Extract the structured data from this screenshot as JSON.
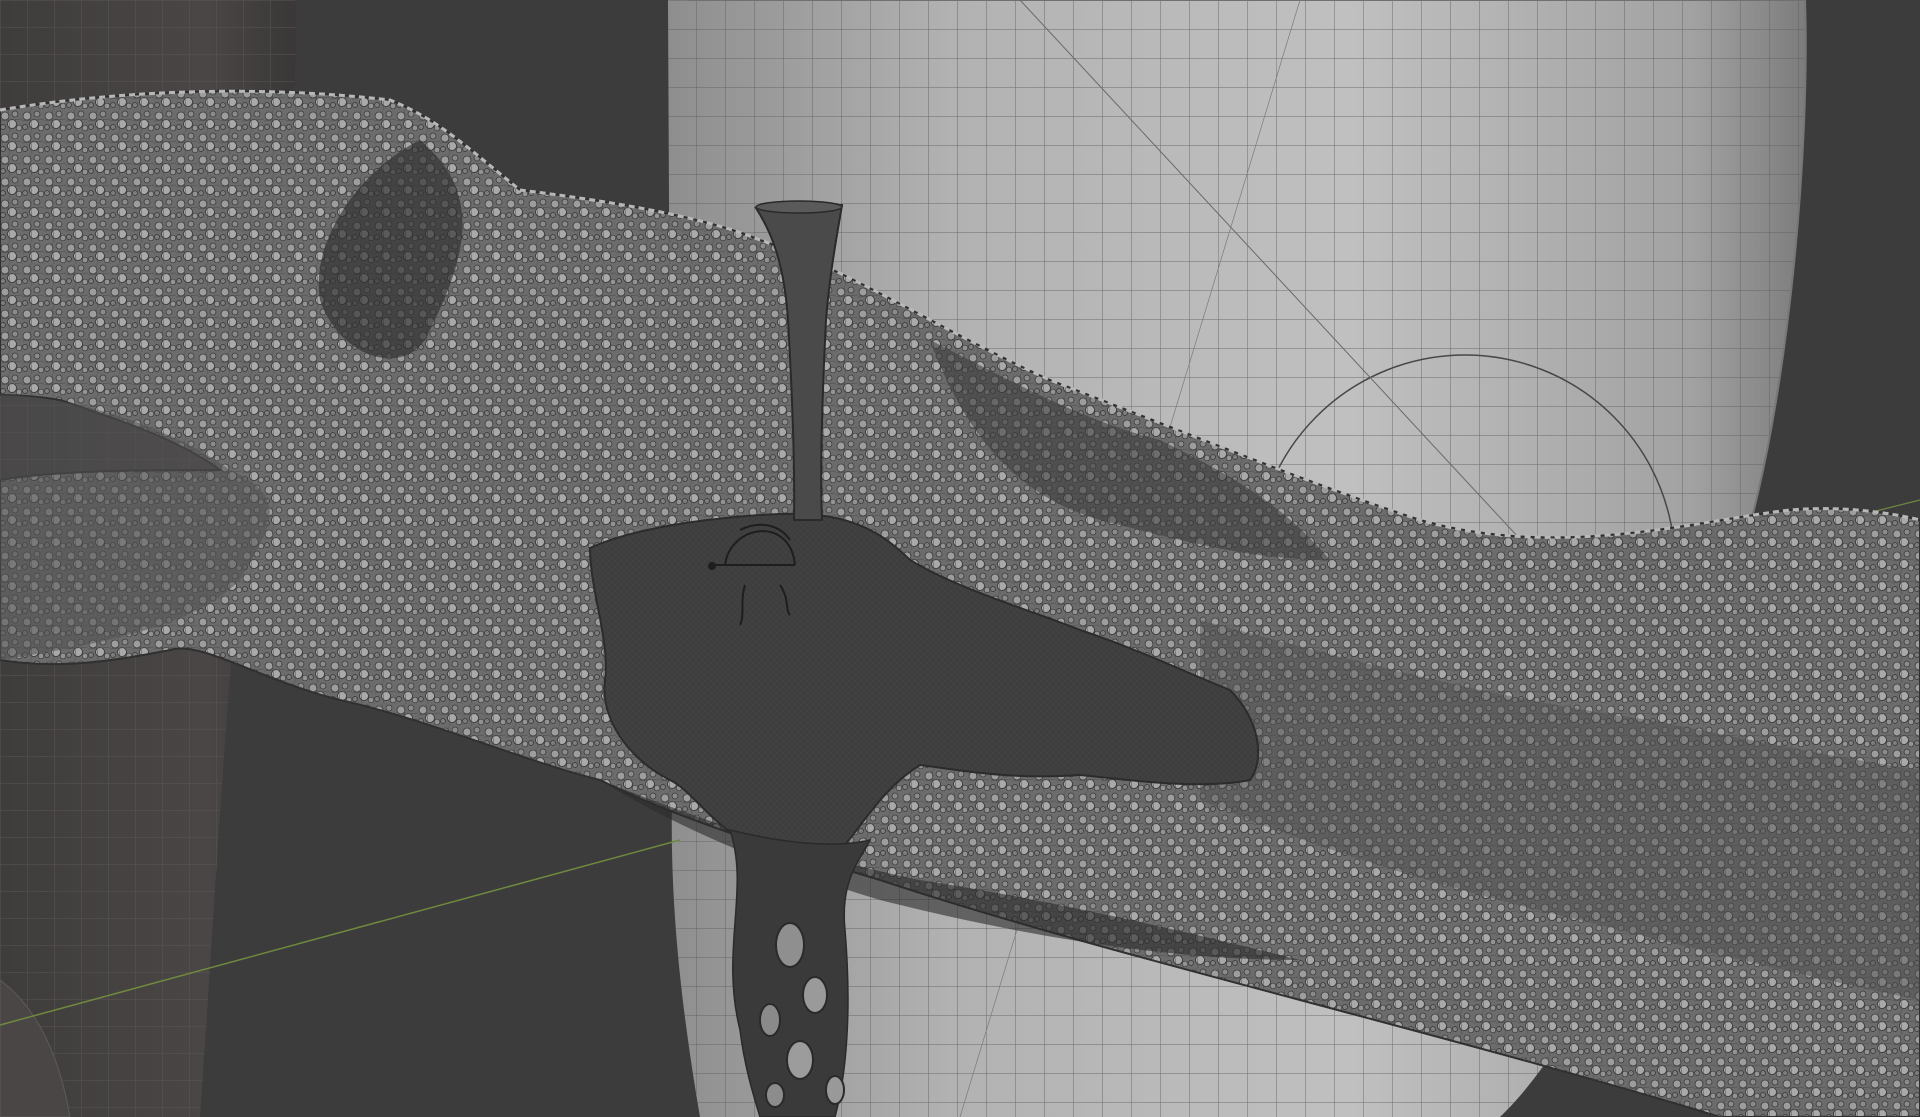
{
  "viewport": {
    "label": "",
    "background_color": "#3c3c3c",
    "cylinder_right": {
      "fill_color": "#a9a9a9",
      "wire_color": "#5a5a5a",
      "lit_color": "#c2c2c2"
    },
    "cylinder_left": {
      "fill_color": "#474444",
      "wire_color": "#5e5a5a"
    },
    "branch": {
      "fill_color": "#6e6e6e",
      "detail_color": "#a3a3a3",
      "dark_color": "#262626",
      "wire_color": "#3a3a3a"
    },
    "fungus_cap": {
      "fill_color": "#3e3e3e",
      "edge_color": "#2c2c2c"
    },
    "stem": {
      "fill_color": "#4a4a4a"
    },
    "drip": {
      "fill_color": "#3a3a3a"
    },
    "lamp_gizmo": {
      "line_color": "#1e1e1e"
    },
    "light_circle": {
      "line_color": "#474747"
    },
    "ground_axis_line": {
      "line_color": "#6f8a3e"
    }
  }
}
